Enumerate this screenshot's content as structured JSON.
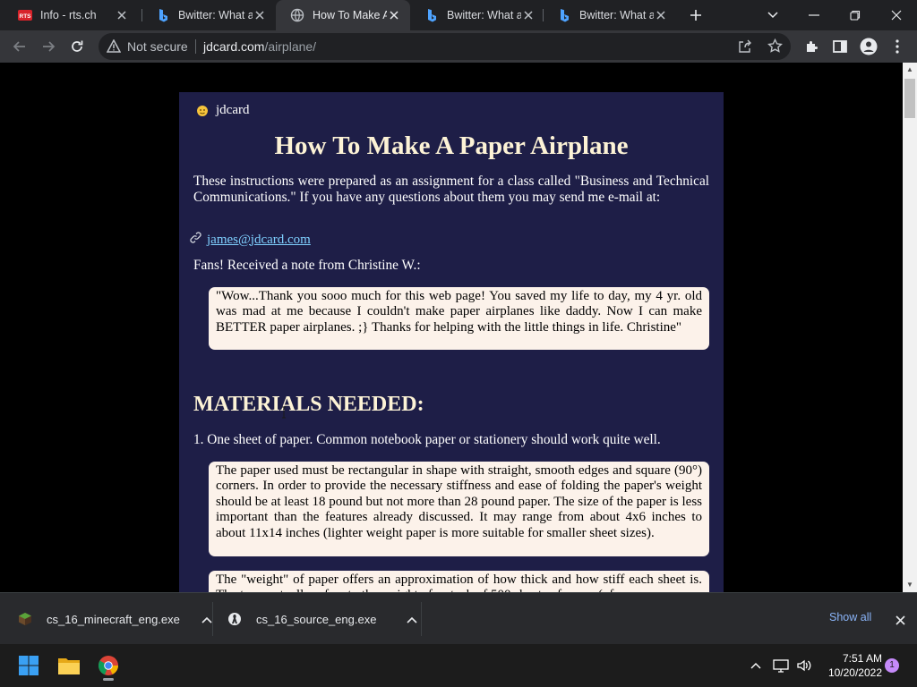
{
  "browser": {
    "tabs": [
      {
        "title": "Info - rts.ch",
        "favicon": "rts-icon",
        "active": false
      },
      {
        "title": "Bwitter: What are",
        "favicon": "bing-icon",
        "active": false
      },
      {
        "title": "How To Make A P",
        "favicon": "globe-icon",
        "active": true
      },
      {
        "title": "Bwitter: What are",
        "favicon": "bing-icon",
        "active": false
      },
      {
        "title": "Bwitter: What are",
        "favicon": "bing-icon",
        "active": false
      }
    ],
    "new_tab_icon": "plus-icon",
    "window_controls": [
      "tab-search-icon",
      "minimize-icon",
      "restore-icon",
      "close-icon"
    ],
    "toolbar": {
      "security_label": "Not secure",
      "url_domain": "jdcard.com",
      "url_path": "/airplane/"
    }
  },
  "page": {
    "brand": "jdcard",
    "title": "How To Make A Paper Airplane",
    "intro": "These instructions were prepared as an assignment for a class called \"Business and Technical Communications.\" If you have any questions about them you may send me e-mail at:",
    "email": "james@jdcard.com",
    "fans_note": "Fans! Received a note from Christine W.:",
    "quote": "\"Wow...Thank you sooo much for this web page! You saved my life to day, my 4 yr. old was mad at me because I couldn't make paper airplanes like daddy. Now I can make BETTER paper airplanes. ;} Thanks for helping with the little things in life. Christine\"",
    "materials_heading": "MATERIALS NEEDED:",
    "material_1": "1. One sheet of paper. Common notebook paper or stationery should work quite well.",
    "paper_note": "The paper used must be rectangular in shape with straight, smooth edges and square (90°) corners. In order to provide the necessary stiffness and ease of folding the paper's weight should be at least 18 pound but not more than 28 pound paper. The size of the paper is less important than the features already discussed. It may range from about 4x6 inches to about 11x14 inches (lighter weight paper is more suitable for smaller sheet sizes).",
    "weight_note": "The \"weight\" of paper offers an approximation of how thick and how stiff each sheet is. The term actually refers to the weight of a stack of 500 sheets of paper (of a"
  },
  "downloads": {
    "items": [
      {
        "name": "cs_16_minecraft_eng.exe"
      },
      {
        "name": "cs_16_source_eng.exe"
      }
    ],
    "show_all": "Show all"
  },
  "taskbar": {
    "time": "7:51 AM",
    "date": "10/20/2022",
    "notification_count": "1"
  },
  "colors": {
    "page_bg": "#1e1e47",
    "heading": "#fdf3d6",
    "link": "#7fd0ff",
    "quote_bg": "#fcf2ea"
  }
}
